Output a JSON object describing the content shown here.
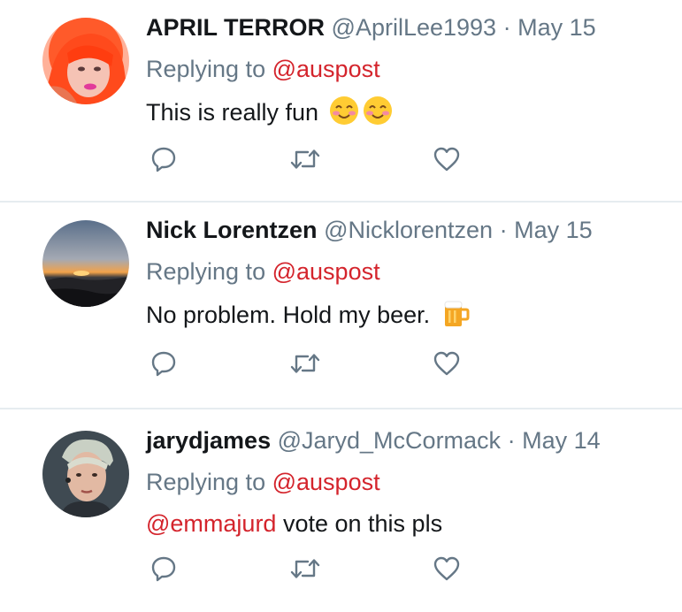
{
  "colors": {
    "name": "#14171a",
    "meta": "#657786",
    "mention": "#d4242c",
    "divider": "#e6ecf0",
    "action_icon": "#657786"
  },
  "tweets": [
    {
      "fullname": "APRIL TERROR",
      "handle": "@AprilLee1993",
      "dot": "·",
      "date": "May 15",
      "replying_prefix": "Replying to",
      "replying_to": "@auspost",
      "text": "This is really fun",
      "emoji": [
        "smiling-face-emoji",
        "smiling-face-emoji"
      ],
      "avatar_icon": "orange-hair-avatar"
    },
    {
      "fullname": "Nick Lorentzen",
      "handle": "@Nicklorentzen",
      "dot": "·",
      "date": "May 15",
      "replying_prefix": "Replying to",
      "replying_to": "@auspost",
      "text": "No problem. Hold my beer.",
      "emoji": [
        "beer-mug-emoji"
      ],
      "avatar_icon": "sunset-avatar"
    },
    {
      "fullname": "jarydjames",
      "handle": "@Jaryd_McCormack",
      "dot": "·",
      "date": "May 14",
      "replying_prefix": "Replying to",
      "replying_to": "@auspost",
      "text_mention": "@emmajurd",
      "text": "vote on this pls",
      "emoji": [],
      "avatar_icon": "portrait-avatar"
    }
  ],
  "action_icons": [
    "reply-icon",
    "retweet-icon",
    "like-icon"
  ]
}
